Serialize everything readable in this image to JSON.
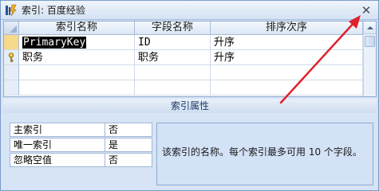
{
  "window": {
    "title": "索引: 百度经验",
    "icon": "lightning-bolt-icon",
    "close_glyph": "✕"
  },
  "grid": {
    "columns": [
      "索引名称",
      "字段名称",
      "排序次序"
    ],
    "rows": [
      {
        "index_name": "PrimaryKey",
        "field_name": "ID",
        "sort_order": "升序",
        "selector": "current-row",
        "name_selected": true
      },
      {
        "index_name": "职务",
        "field_name": "职务",
        "sort_order": "升序",
        "selector": "key-icon"
      },
      {
        "index_name": "",
        "field_name": "",
        "sort_order": ""
      },
      {
        "index_name": "",
        "field_name": "",
        "sort_order": ""
      }
    ]
  },
  "properties": {
    "header": "索引属性",
    "items": [
      {
        "label": "主索引",
        "value": "否"
      },
      {
        "label": "唯一索引",
        "value": "是"
      },
      {
        "label": "忽略空值",
        "value": "否"
      }
    ],
    "hint": "该索引的名称。每个索引最多可用 10 个字段。"
  },
  "colors": {
    "arrow": "#e0202a",
    "selection_bg": "#000000",
    "current_row": "#f6d98b"
  }
}
